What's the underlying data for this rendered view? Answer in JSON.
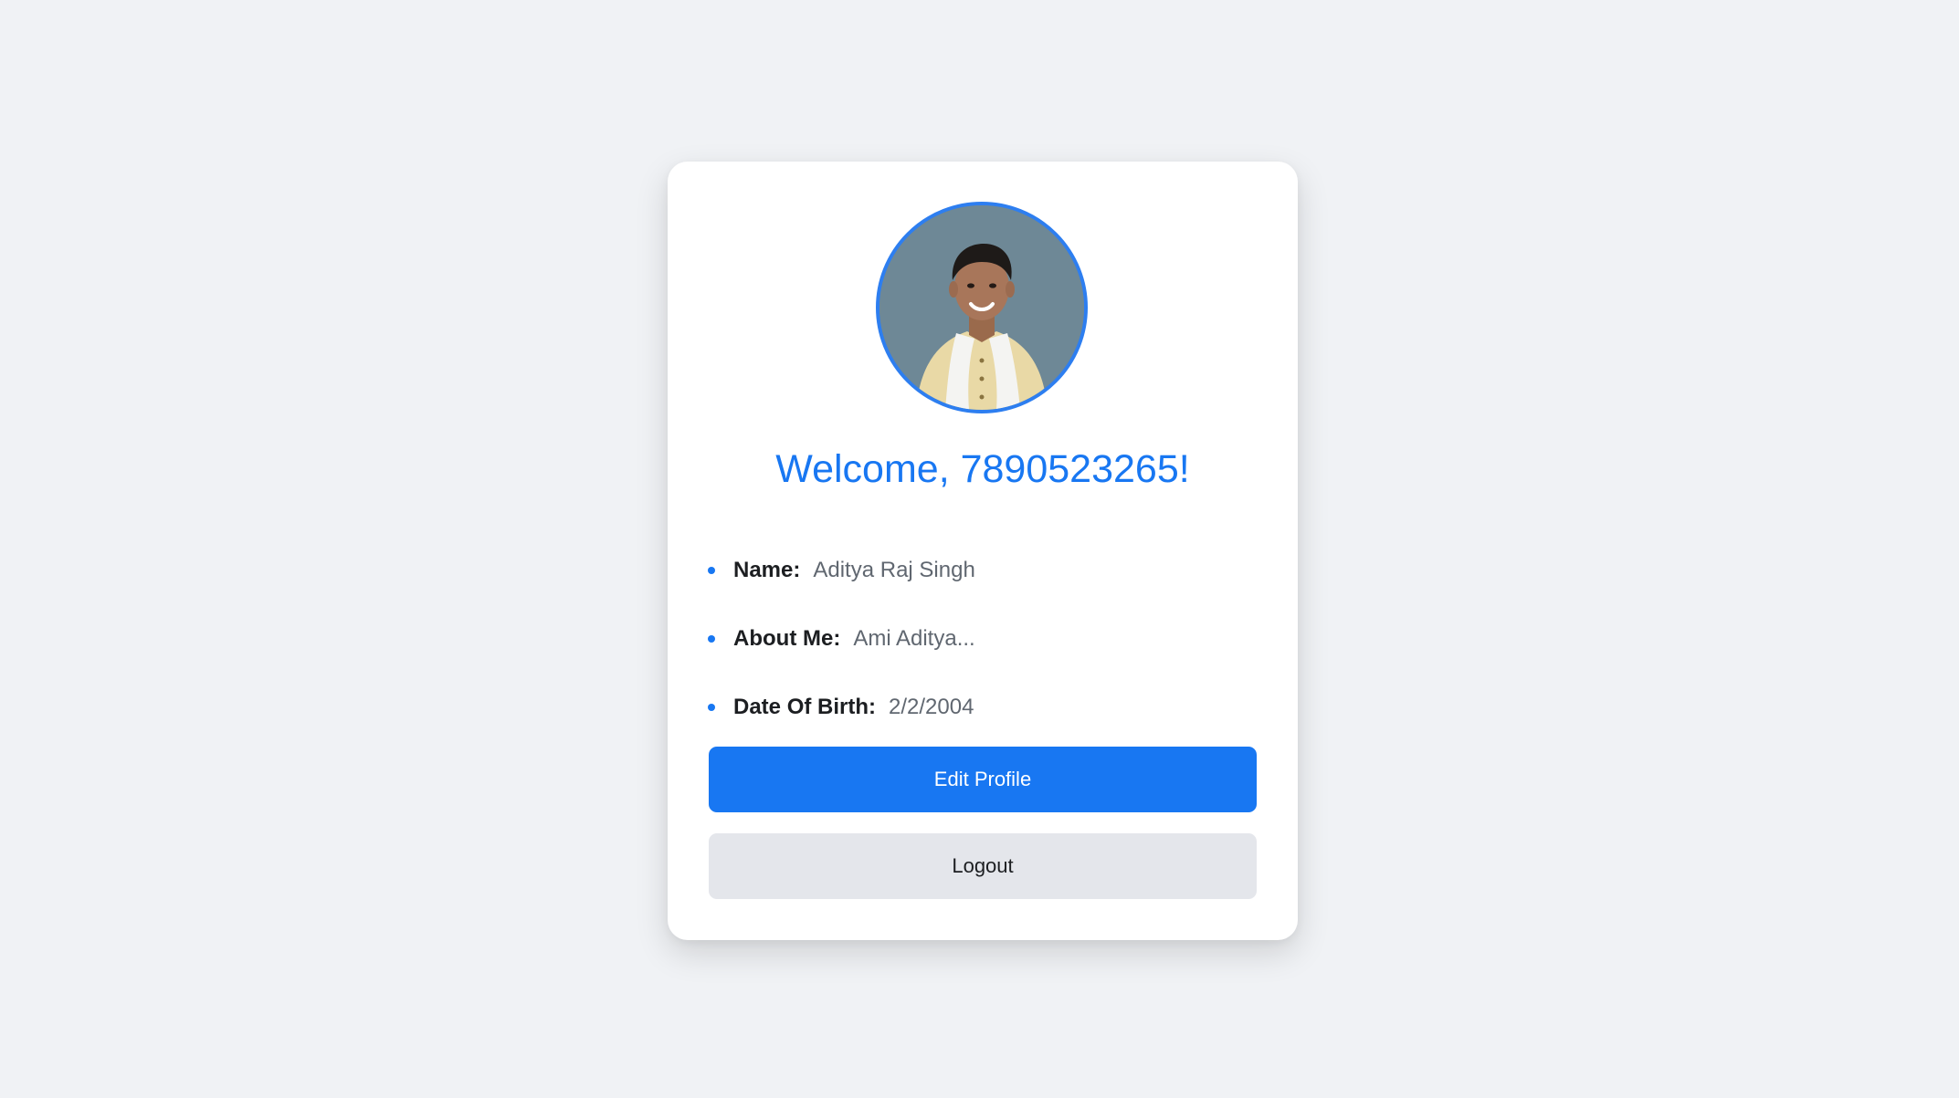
{
  "profile": {
    "welcome": "Welcome, 7890523265!",
    "avatar_icon": "user-avatar-photo",
    "details": [
      {
        "label": "Name:",
        "value": "Aditya Raj Singh"
      },
      {
        "label": "About Me:",
        "value": "Ami Aditya..."
      },
      {
        "label": "Date Of Birth:",
        "value": "2/2/2004"
      }
    ]
  },
  "actions": {
    "edit_label": "Edit Profile",
    "logout_label": "Logout"
  },
  "colors": {
    "accent": "#1877f2",
    "background": "#f0f2f5",
    "card": "#ffffff",
    "secondary_button": "#e4e6eb",
    "avatar_border": "#2d7ef0"
  }
}
